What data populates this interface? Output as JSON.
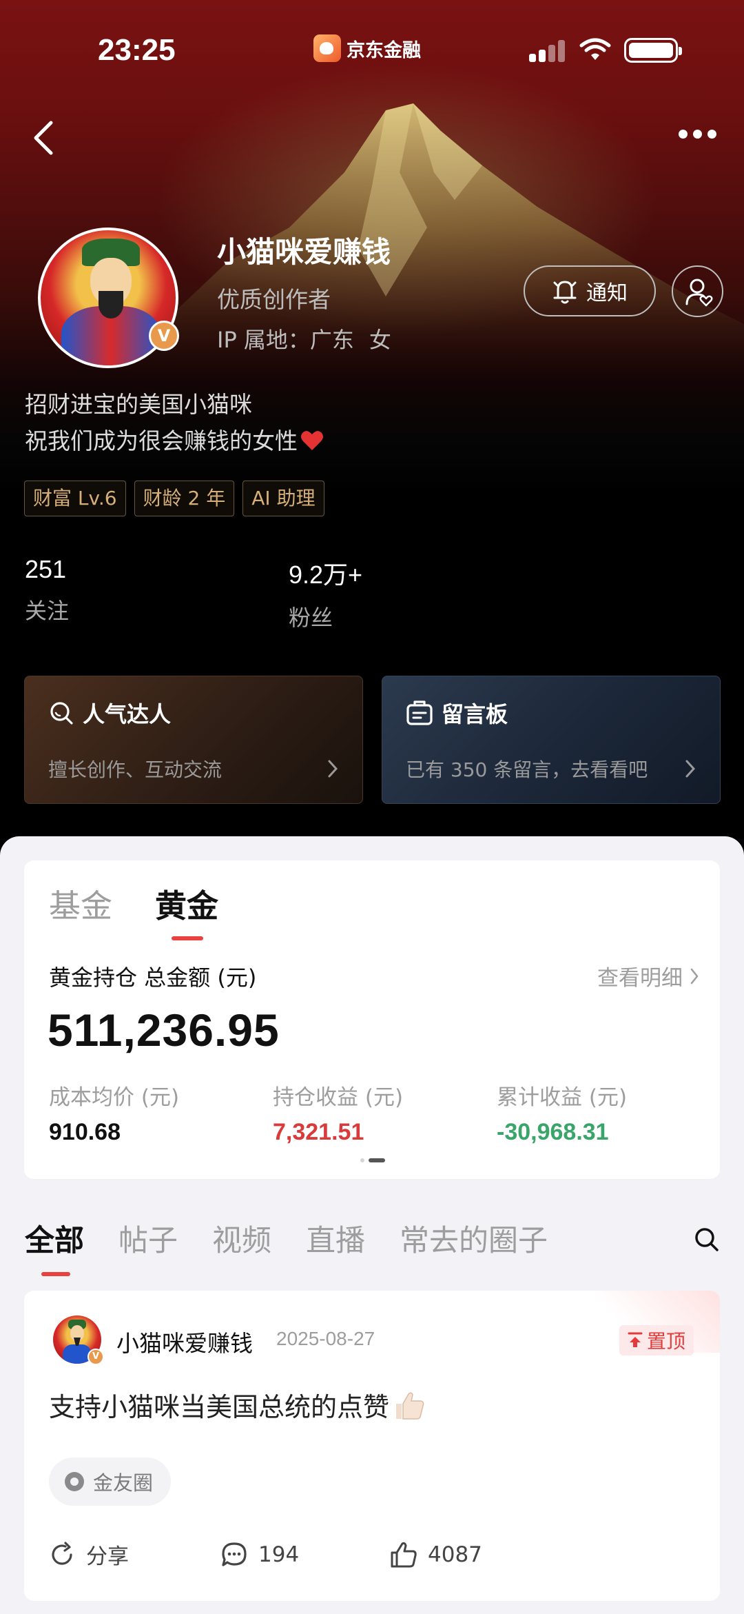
{
  "status_bar": {
    "time": "23:25",
    "app_name": "京东金融"
  },
  "profile": {
    "name": "小猫咪爱赚钱",
    "role": "优质创作者",
    "ip_location": "IP 属地：广东",
    "gender": "女",
    "verified_badge": "V",
    "notify_label": "通知",
    "bio_line1": "招财进宝的美国小猫咪",
    "bio_line2": "祝我们成为很会赚钱的女性",
    "tags": [
      "财富 Lv.6",
      "财龄 2 年",
      "AI 助理"
    ],
    "stats": [
      {
        "value": "251",
        "label": "关注"
      },
      {
        "value": "9.2万+",
        "label": "粉丝"
      }
    ],
    "feature_cards": [
      {
        "title": "人气达人",
        "subtitle": "擅长创作、互动交流",
        "icon": "search-icon"
      },
      {
        "title": "留言板",
        "subtitle": "已有 350 条留言，去看看吧",
        "icon": "message-board-icon"
      }
    ]
  },
  "holdings": {
    "tabs": [
      "基金",
      "黄金"
    ],
    "active_tab": "黄金",
    "title": "黄金持仓 总金额 (元)",
    "detail_link": "查看明细",
    "total": "511,236.95",
    "stats": [
      {
        "label": "成本均价 (元)",
        "value": "910.68",
        "color": "#111111"
      },
      {
        "label": "持仓收益 (元)",
        "value": "7,321.51",
        "color": "#d93a3a"
      },
      {
        "label": "累计收益 (元)",
        "value": "-30,968.31",
        "color": "#3aa56a"
      }
    ]
  },
  "feed_tabs": [
    "全部",
    "帖子",
    "视频",
    "直播",
    "常去的圈子"
  ],
  "post": {
    "author": "小猫咪爱赚钱",
    "date": "2025-08-27",
    "pinned_label": "置顶",
    "text": "支持小猫咪当美国总统的点赞",
    "circle": "金友圈",
    "share_label": "分享",
    "comments": "194",
    "likes": "4087"
  },
  "colors": {
    "accent": "#e94040",
    "tag_gold": "#d6ae78",
    "hero_red": "#7a1212"
  }
}
